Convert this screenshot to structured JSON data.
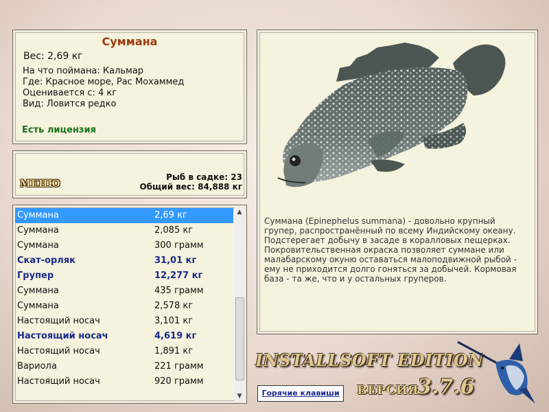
{
  "info": {
    "title": "Суммана",
    "weight": "Вес: 2,69 кг",
    "bait": "На что поймана: Кальмар",
    "location": "Где: Красное море, Рас Мохаммед",
    "estimated": "Оценивается с: 4 кг",
    "species": "Вид: Ловится редко",
    "license": "Есть лицензия"
  },
  "stats": {
    "menu_label": "МЕНЮ",
    "fish_in_cage": "Рыб в садке: 23",
    "total_weight": "Общий вес: 84,888 кг"
  },
  "catch_list": [
    {
      "name": "Суммана",
      "weight": "2,69 кг",
      "selected": true,
      "highlight": false
    },
    {
      "name": "Суммана",
      "weight": "2,085 кг",
      "selected": false,
      "highlight": false
    },
    {
      "name": "Суммана",
      "weight": "300 грамм",
      "selected": false,
      "highlight": false
    },
    {
      "name": "Скат-орляк",
      "weight": "31,01 кг",
      "selected": false,
      "highlight": true
    },
    {
      "name": "Групер",
      "weight": "12,277 кг",
      "selected": false,
      "highlight": true
    },
    {
      "name": "Суммана",
      "weight": "435 грамм",
      "selected": false,
      "highlight": false
    },
    {
      "name": "Суммана",
      "weight": "2,578 кг",
      "selected": false,
      "highlight": false
    },
    {
      "name": "Настоящий носач",
      "weight": "3,101 кг",
      "selected": false,
      "highlight": false
    },
    {
      "name": "Настоящий носач",
      "weight": "4,619 кг",
      "selected": false,
      "highlight": true
    },
    {
      "name": "Настоящий носач",
      "weight": "1,891 кг",
      "selected": false,
      "highlight": false
    },
    {
      "name": "Вариола",
      "weight": "221 грамм",
      "selected": false,
      "highlight": false
    },
    {
      "name": "Настоящий носач",
      "weight": "920 грамм",
      "selected": false,
      "highlight": false
    }
  ],
  "fish": {
    "description": "Суммана (Epinephelus summana) - довольно крупный групер, распространённый по всему Индийскому океану. Подстерегает добычу в засаде в коралловых пещерках. Покровительственная окраска позволяет суммане или малабарскому окуню оставаться малоподвижной рыбой - ему не приходится долго гоняться за добычей. Кормовая база - та же, что и у остальных груперов."
  },
  "footer": {
    "edition": "INSTALLSOFT EDITION",
    "version_label": "ВЕРСИЯ",
    "version_number": "3.7.6",
    "hotkeys": "Горячие клавиши"
  },
  "icons": {
    "scroll_up": "triangle-up-icon",
    "scroll_down": "triangle-down-icon",
    "fish_picture": "grouper-image",
    "logo": "marlin-logo"
  },
  "colors": {
    "title": "#9c3a10",
    "license": "#1a6e1a",
    "selection": "#3399ff",
    "highlight": "#1a2a8a",
    "panel": "#f5f2dd"
  }
}
